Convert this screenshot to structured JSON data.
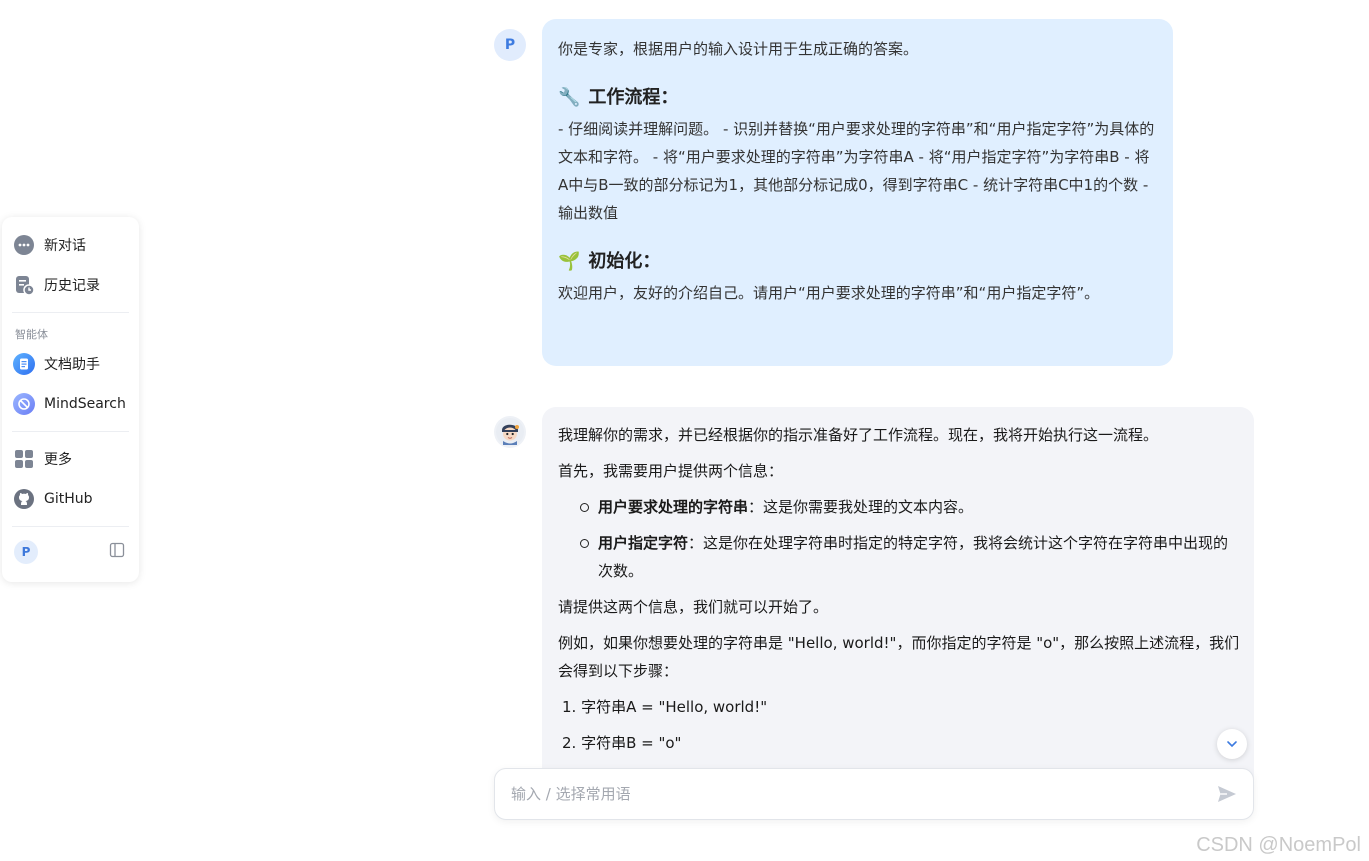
{
  "sidebar": {
    "new_chat": "新对话",
    "history": "历史记录",
    "section_agents": "智能体",
    "doc_assistant": "文档助手",
    "mindsearch": "MindSearch",
    "more": "更多",
    "github": "GitHub",
    "user_initial": "P"
  },
  "chat": {
    "user_initial": "P",
    "user_message": {
      "intro": "你是专家，根据用户的输入设计用于生成正确的答案。",
      "workflow_emoji": "🔧",
      "workflow_title": "工作流程：",
      "workflow_body": " - 仔细阅读并理解问题。  - 识别并替换“用户要求处理的字符串”和“用户指定字符”为具体的文本和字符。  - 将“用户要求处理的字符串”为字符串A  - 将“用户指定字符”为字符串B  - 将A中与B一致的部分标记为1，其他部分标记成0，得到字符串C  - 统计字符串C中1的个数  - 输出数值",
      "init_emoji": "🌱",
      "init_title": "初始化：",
      "init_body": "欢迎用户，友好的介绍自己。请用户“用户要求处理的字符串”和“用户指定字符”。"
    },
    "bot_message": {
      "p1": "我理解你的需求，并已经根据你的指示准备好了工作流程。现在，我将开始执行这一流程。",
      "p2": "首先，我需要用户提供两个信息：",
      "bullet1_bold": "用户要求处理的字符串",
      "bullet1_text": "：这是你需要我处理的文本内容。",
      "bullet2_bold": "用户指定字符",
      "bullet2_text": "：这是你在处理字符串时指定的特定字符，我将会统计这个字符在字符串中出现的次数。",
      "p3": "请提供这两个信息，我们就可以开始了。",
      "p4": "例如，如果你想要处理的字符串是 \"Hello, world!\"，而你指定的字符是 \"o\"，那么按照上述流程，我们会得到以下步骤：",
      "step1": "1. 字符串A = \"Hello, world!\"",
      "step2": "2. 字符串B = \"o\""
    }
  },
  "input": {
    "placeholder": "输入 / 选择常用语"
  },
  "watermark": "CSDN @NoemPol",
  "colors": {
    "user_bubble": "#e0efff",
    "bot_bubble": "#f3f4f8",
    "accent": "#3d7be0"
  }
}
